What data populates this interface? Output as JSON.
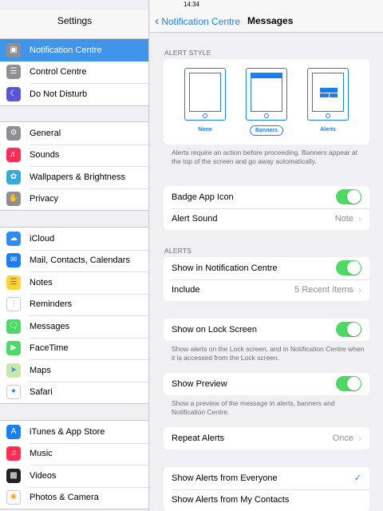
{
  "status": {
    "time": "14:34"
  },
  "left": {
    "title": "Settings",
    "groups": [
      {
        "items": [
          {
            "label": "Notification Centre",
            "icon": "notification-centre-icon"
          },
          {
            "label": "Control Centre",
            "icon": "control-centre-icon"
          },
          {
            "label": "Do Not Disturb",
            "icon": "moon-icon"
          }
        ]
      },
      {
        "items": [
          {
            "label": "General",
            "icon": "gear-icon"
          },
          {
            "label": "Sounds",
            "icon": "speaker-icon"
          },
          {
            "label": "Wallpapers & Brightness",
            "icon": "flower-icon"
          },
          {
            "label": "Privacy",
            "icon": "hand-icon"
          }
        ]
      },
      {
        "items": [
          {
            "label": "iCloud",
            "icon": "cloud-icon"
          },
          {
            "label": "Mail, Contacts, Calendars",
            "icon": "mail-icon"
          },
          {
            "label": "Notes",
            "icon": "notes-icon"
          },
          {
            "label": "Reminders",
            "icon": "reminders-icon"
          },
          {
            "label": "Messages",
            "icon": "messages-icon"
          },
          {
            "label": "FaceTime",
            "icon": "facetime-icon"
          },
          {
            "label": "Maps",
            "icon": "maps-icon"
          },
          {
            "label": "Safari",
            "icon": "compass-icon"
          }
        ]
      },
      {
        "items": [
          {
            "label": "iTunes & App Store",
            "icon": "app-store-icon"
          },
          {
            "label": "Music",
            "icon": "music-icon"
          },
          {
            "label": "Videos",
            "icon": "videos-icon"
          },
          {
            "label": "Photos & Camera",
            "icon": "photos-icon"
          }
        ]
      }
    ]
  },
  "right": {
    "back_label": "Notification Centre",
    "title": "Messages",
    "alert_style": {
      "header": "ALERT STYLE",
      "options": [
        "None",
        "Banners",
        "Alerts"
      ],
      "note": "Alerts require an action before proceeding. Banners appear at the top of the screen and go away automatically."
    },
    "badge_app_icon": "Badge App Icon",
    "alert_sound": {
      "label": "Alert Sound",
      "value": "Note"
    },
    "alerts_header": "ALERTS",
    "show_in_nc": "Show in Notification Centre",
    "include": {
      "label": "Include",
      "value": "5 Recent Items"
    },
    "lock_screen": {
      "label": "Show on Lock Screen",
      "note": "Show alerts on the Lock screen, and in Notification Centre when it is accessed from the Lock screen."
    },
    "preview": {
      "label": "Show Preview",
      "note": "Show a preview of the message in alerts, banners and Notification Centre."
    },
    "repeat_alerts": {
      "label": "Repeat Alerts",
      "value": "Once"
    },
    "alerts_from_everyone": "Show Alerts from Everyone",
    "alerts_from_contacts": "Show Alerts from My Contacts"
  },
  "colors": {
    "accent": "#1a7ef5",
    "selected": "#3f95ea",
    "switch_on": "#4cd964"
  }
}
